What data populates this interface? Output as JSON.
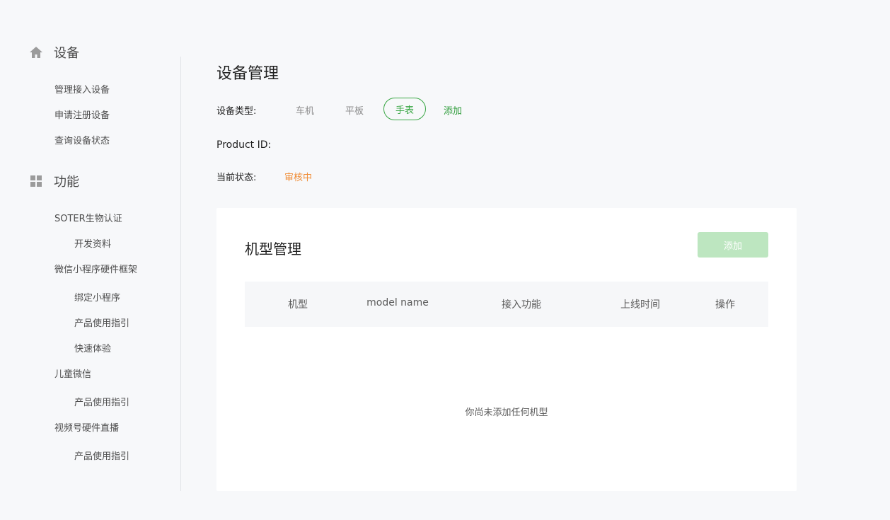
{
  "sidebar": {
    "devices": {
      "title": "设备",
      "items": [
        "管理接入设备",
        "申请注册设备",
        "查询设备状态"
      ]
    },
    "features": {
      "title": "功能",
      "groups": [
        {
          "label": "SOTER生物认证",
          "children": [
            "开发资料"
          ]
        },
        {
          "label": "微信小程序硬件框架",
          "children": [
            "绑定小程序",
            "产品使用指引",
            "快速体验"
          ]
        },
        {
          "label": "儿童微信",
          "children": [
            "产品使用指引"
          ]
        },
        {
          "label": "视频号硬件直播",
          "children": [
            "产品使用指引"
          ]
        }
      ]
    }
  },
  "main": {
    "title": "设备管理",
    "device_type_label": "设备类型:",
    "device_types": [
      "车机",
      "平板",
      "手表"
    ],
    "selected_type": "手表",
    "add_type_label": "添加",
    "product_id_label": "Product ID:",
    "status_label": "当前状态:",
    "status_value": "审核中",
    "status_color": "#f08c34"
  },
  "model_card": {
    "title": "机型管理",
    "add_label": "添加",
    "columns": [
      "机型",
      "model name",
      "接入功能",
      "上线时间",
      "操作"
    ],
    "empty_text": "你尚未添加任何机型"
  },
  "colors": {
    "accent": "#3aa745",
    "accent_light": "#bde6c0",
    "background": "#f7f8fa"
  }
}
